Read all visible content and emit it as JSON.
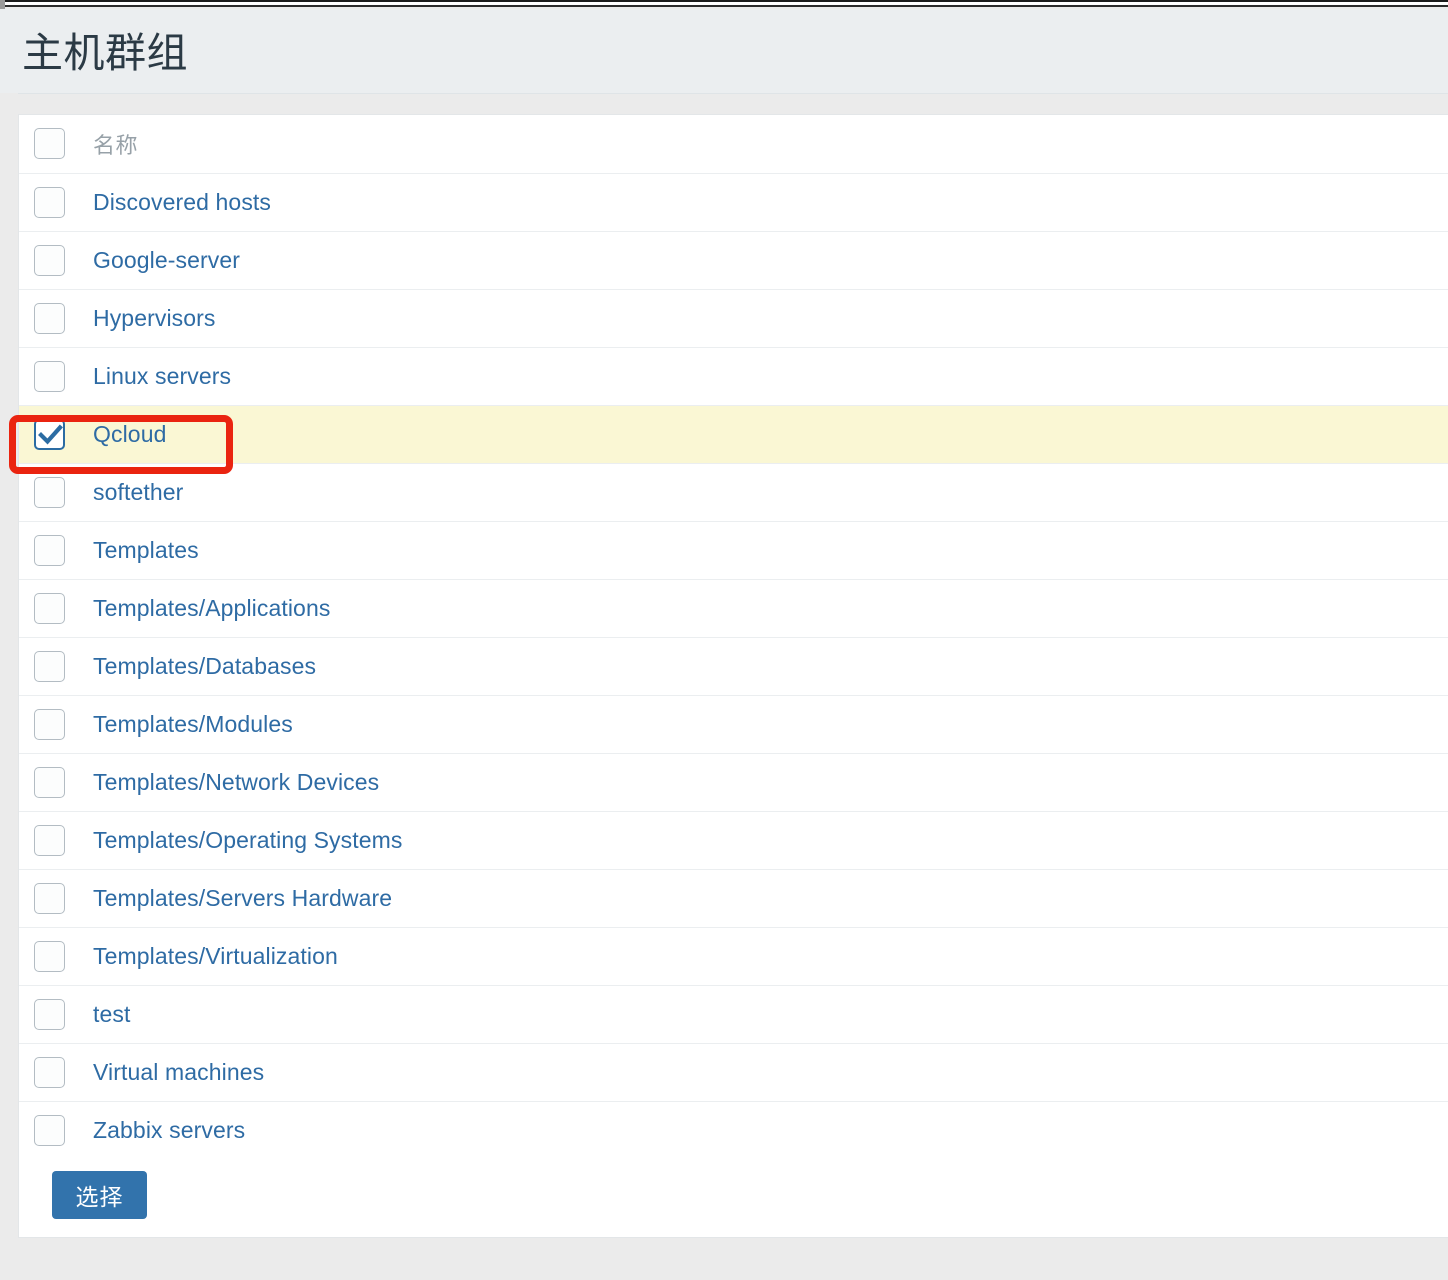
{
  "window": {
    "title": "主机群组"
  },
  "table": {
    "header": {
      "name_column": "名称"
    },
    "rows": [
      {
        "label": "Discovered hosts",
        "checked": false,
        "highlighted": false
      },
      {
        "label": "Google-server",
        "checked": false,
        "highlighted": false
      },
      {
        "label": "Hypervisors",
        "checked": false,
        "highlighted": false
      },
      {
        "label": "Linux servers",
        "checked": false,
        "highlighted": false
      },
      {
        "label": "Qcloud",
        "checked": true,
        "highlighted": true
      },
      {
        "label": "softether",
        "checked": false,
        "highlighted": false
      },
      {
        "label": "Templates",
        "checked": false,
        "highlighted": false
      },
      {
        "label": "Templates/Applications",
        "checked": false,
        "highlighted": false
      },
      {
        "label": "Templates/Databases",
        "checked": false,
        "highlighted": false
      },
      {
        "label": "Templates/Modules",
        "checked": false,
        "highlighted": false
      },
      {
        "label": "Templates/Network Devices",
        "checked": false,
        "highlighted": false
      },
      {
        "label": "Templates/Operating Systems",
        "checked": false,
        "highlighted": false
      },
      {
        "label": "Templates/Servers Hardware",
        "checked": false,
        "highlighted": false
      },
      {
        "label": "Templates/Virtualization",
        "checked": false,
        "highlighted": false
      },
      {
        "label": "test",
        "checked": false,
        "highlighted": false
      },
      {
        "label": "Virtual machines",
        "checked": false,
        "highlighted": false
      },
      {
        "label": "Zabbix servers",
        "checked": false,
        "highlighted": false
      }
    ]
  },
  "footer": {
    "select_label": "选择"
  },
  "annotation": {
    "type": "highlight-rectangle",
    "target_row_label": "Qcloud",
    "color": "#ea2410"
  },
  "colors": {
    "link": "#2e6ba4",
    "button": "#3273ac",
    "highlight_row": "#faf7d4",
    "header_bg": "#ebeef0",
    "page_bg": "#ebebeb",
    "annotation": "#ea2410"
  }
}
